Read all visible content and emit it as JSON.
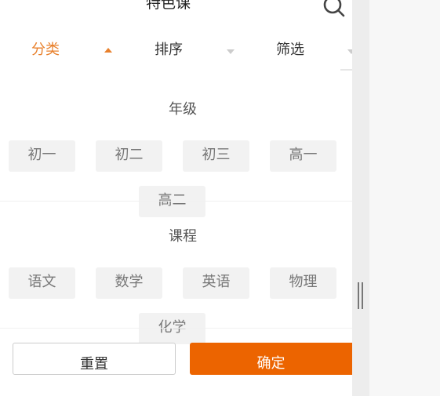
{
  "header": {
    "title": "特色课"
  },
  "filter_tabs": [
    {
      "label": "分类",
      "active": true
    },
    {
      "label": "排序",
      "active": false
    },
    {
      "label": "筛选",
      "active": false
    }
  ],
  "grade": {
    "title": "年级",
    "options": [
      "初一",
      "初二",
      "初三",
      "高一",
      "高二"
    ]
  },
  "course": {
    "title": "课程",
    "options": [
      "语文",
      "数学",
      "英语",
      "物理",
      "化学"
    ]
  },
  "actions": {
    "reset_label": "重置",
    "confirm_label": "确定"
  },
  "colors": {
    "accent": "#e8802c",
    "confirm_bg": "#ec6400",
    "chip_bg": "#f2f2f2"
  },
  "icons": {
    "search": "search-icon",
    "active_caret": "caret-up-icon",
    "caret": "caret-down-icon"
  }
}
